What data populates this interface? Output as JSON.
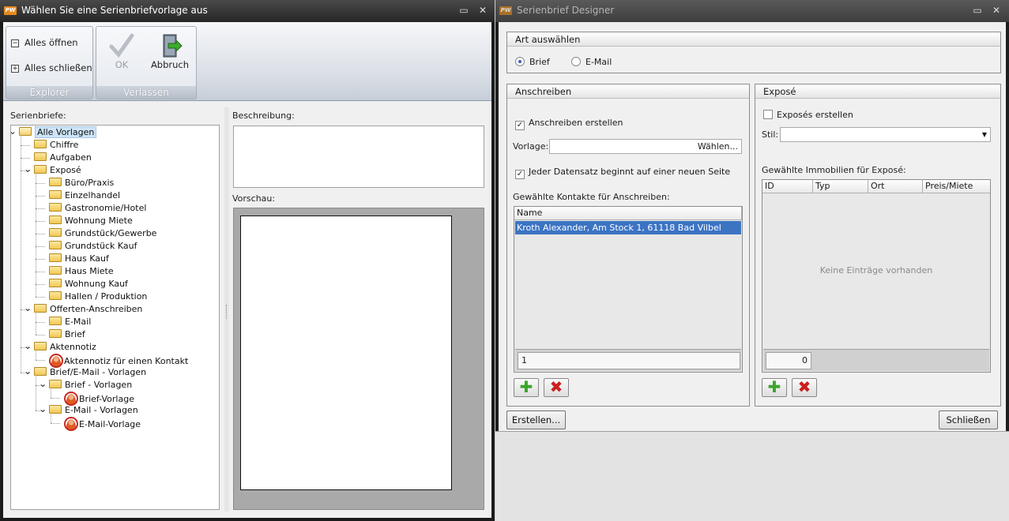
{
  "left_window": {
    "logo": "PW",
    "title": "Wählen Sie eine Serienbriefvorlage aus",
    "ribbon": {
      "explorer_group": {
        "label": "Explorer",
        "expand_all": "Alles öffnen",
        "collapse_all": "Alles schließen"
      },
      "leave_group": {
        "label": "Verlassen",
        "ok": "OK",
        "cancel": "Abbruch"
      }
    },
    "tree_label": "Serienbriefe:",
    "tree": [
      {
        "label": "Alle Vorlagen",
        "level": 0,
        "type": "folder-open",
        "expanded": true,
        "selected": true
      },
      {
        "label": "Chiffre",
        "level": 1,
        "type": "folder"
      },
      {
        "label": "Aufgaben",
        "level": 1,
        "type": "folder"
      },
      {
        "label": "Exposé",
        "level": 1,
        "type": "folder",
        "expanded": true
      },
      {
        "label": "Büro/Praxis",
        "level": 2,
        "type": "folder"
      },
      {
        "label": "Einzelhandel",
        "level": 2,
        "type": "folder"
      },
      {
        "label": "Gastronomie/Hotel",
        "level": 2,
        "type": "folder"
      },
      {
        "label": "Wohnung Miete",
        "level": 2,
        "type": "folder"
      },
      {
        "label": "Grundstück/Gewerbe",
        "level": 2,
        "type": "folder"
      },
      {
        "label": "Grundstück Kauf",
        "level": 2,
        "type": "folder"
      },
      {
        "label": "Haus Kauf",
        "level": 2,
        "type": "folder"
      },
      {
        "label": "Haus Miete",
        "level": 2,
        "type": "folder"
      },
      {
        "label": "Wohnung Kauf",
        "level": 2,
        "type": "folder"
      },
      {
        "label": "Hallen / Produktion",
        "level": 2,
        "type": "folder"
      },
      {
        "label": "Offerten-Anschreiben",
        "level": 1,
        "type": "folder",
        "expanded": true
      },
      {
        "label": "E-Mail",
        "level": 2,
        "type": "folder"
      },
      {
        "label": "Brief",
        "level": 2,
        "type": "folder"
      },
      {
        "label": "Aktennotiz",
        "level": 1,
        "type": "folder",
        "expanded": true
      },
      {
        "label": "Aktennotiz für einen Kontakt",
        "level": 2,
        "type": "template"
      },
      {
        "label": "Brief/E-Mail - Vorlagen",
        "level": 1,
        "type": "folder",
        "expanded": true
      },
      {
        "label": "Brief - Vorlagen",
        "level": 2,
        "type": "folder",
        "expanded": true
      },
      {
        "label": "Brief-Vorlage",
        "level": 3,
        "type": "template"
      },
      {
        "label": "E-Mail - Vorlagen",
        "level": 2,
        "type": "folder",
        "expanded": true
      },
      {
        "label": "E-Mail-Vorlage",
        "level": 3,
        "type": "template"
      }
    ],
    "description_label": "Beschreibung:",
    "preview_label": "Vorschau:"
  },
  "right_window": {
    "logo": "PW",
    "title": "Serienbrief Designer",
    "type_section": {
      "header": "Art auswählen",
      "options": [
        "Brief",
        "E-Mail"
      ],
      "selected": "Brief"
    },
    "letter_section": {
      "header": "Anschreiben",
      "create_checkbox": "Anschreiben erstellen",
      "create_checked": true,
      "template_label": "Vorlage:",
      "choose_button": "Wählen...",
      "newpage_checkbox": "Jeder Datensatz beginnt auf einer neuen Seite",
      "newpage_checked": true,
      "contacts_label": "Gewählte Kontakte für Anschreiben:",
      "contacts_column": "Name",
      "contacts": [
        "Kroth Alexander, Am Stock 1, 61118 Bad Vilbel"
      ],
      "count": "1"
    },
    "expose_section": {
      "header": "Exposé",
      "create_checkbox": "Exposés erstellen",
      "create_checked": false,
      "style_label": "Stil:",
      "style_value": "",
      "properties_label": "Gewählte Immobilien für Exposé:",
      "columns": [
        "ID",
        "Typ",
        "Ort",
        "Preis/Miete"
      ],
      "empty_text": "Keine Einträge vorhanden",
      "count": "0"
    },
    "create_button": "Erstellen...",
    "close_button": "Schließen"
  },
  "colors": {
    "titlebar": "#2e2e2e",
    "selection": "#3c74c4",
    "add": "#3aa52a",
    "remove": "#cc1f1f",
    "logo": "#e6891f"
  }
}
